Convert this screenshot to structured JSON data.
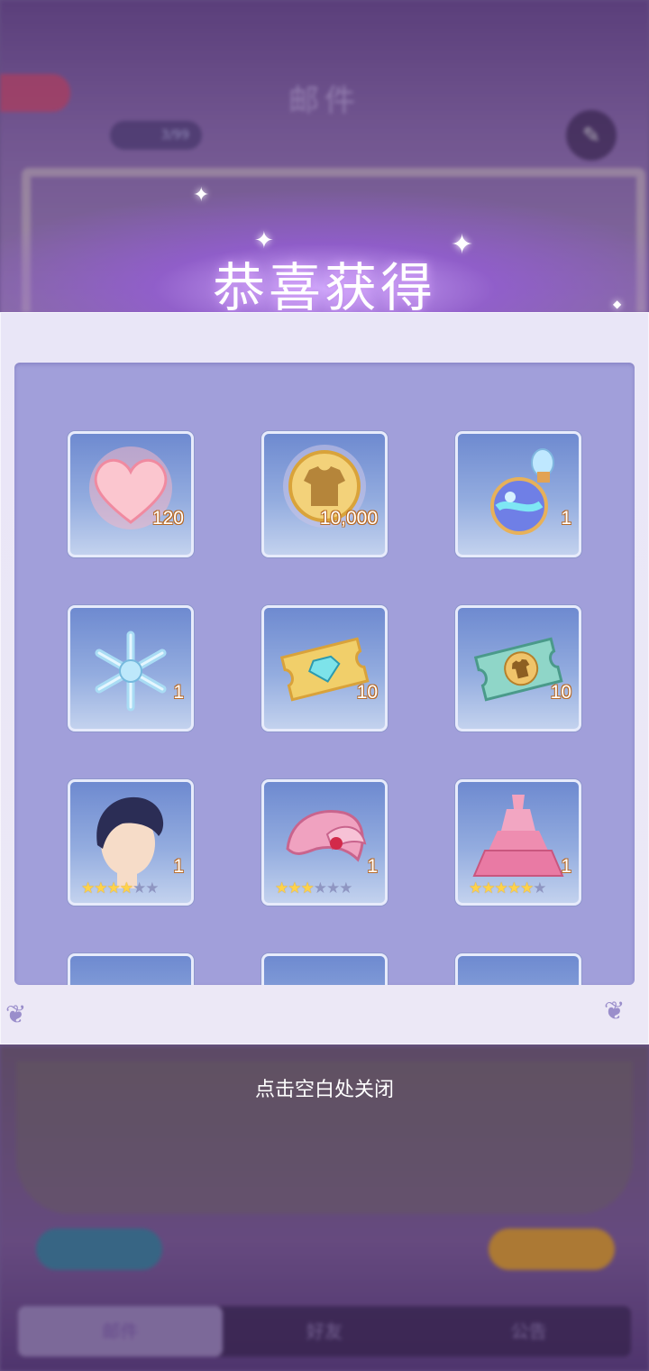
{
  "background": {
    "title": "邮件",
    "counter": "3/99",
    "tabs": [
      "邮件",
      "好友",
      "公告"
    ]
  },
  "reward": {
    "title": "恭喜获得",
    "close_hint": "点击空白处关闭",
    "items": [
      {
        "icon": "heart-icon",
        "qty": "120"
      },
      {
        "icon": "coin-icon",
        "qty": "10,000"
      },
      {
        "icon": "potion-icon",
        "qty": "1"
      },
      {
        "icon": "snowflake-icon",
        "qty": "1"
      },
      {
        "icon": "diamond-ticket-icon",
        "qty": "10"
      },
      {
        "icon": "coin-ticket-icon",
        "qty": "10"
      },
      {
        "icon": "hair-icon",
        "qty": "1",
        "stars": 4,
        "max_stars": 6
      },
      {
        "icon": "bow-icon",
        "qty": "1",
        "stars": 3,
        "max_stars": 6
      },
      {
        "icon": "dress-icon",
        "qty": "1",
        "stars": 5,
        "max_stars": 6
      }
    ]
  },
  "colors": {
    "modal_bg": "#ece8f6",
    "grid_bg": "#a19fda",
    "qty_outline": "#b86a26",
    "star_on": "#ffd24a"
  }
}
